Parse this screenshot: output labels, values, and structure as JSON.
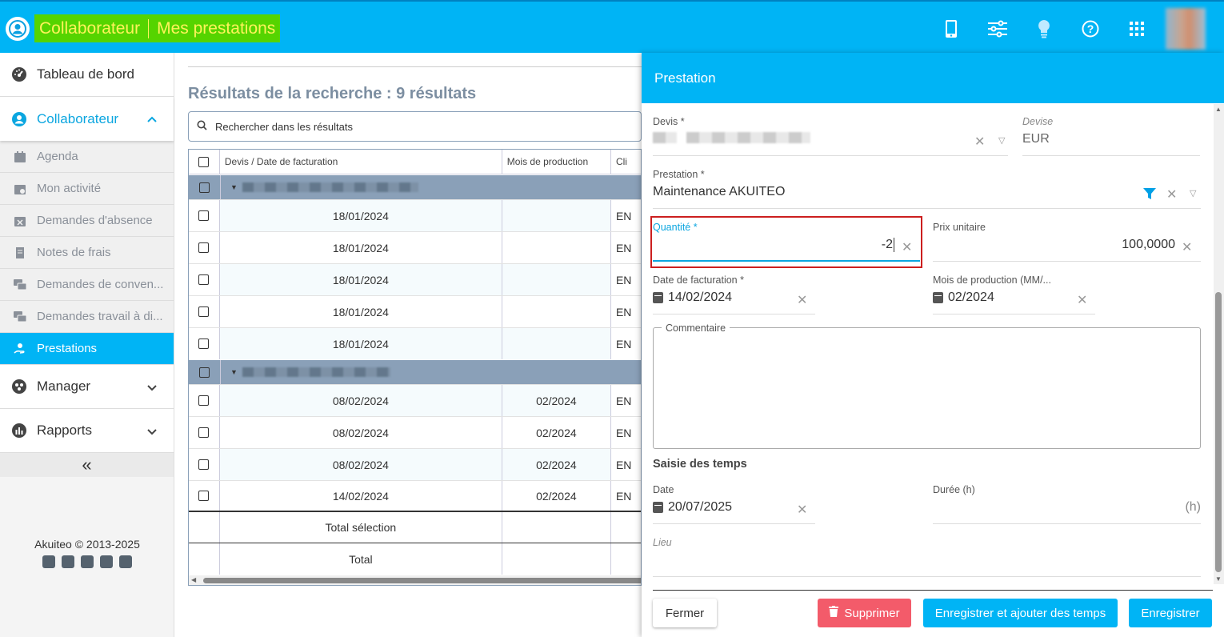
{
  "header": {
    "crumb_section": "Collaborateur",
    "crumb_page": "Mes prestations",
    "icons": [
      "user-circle-icon",
      "mobile-icon",
      "sliders-icon",
      "lightbulb-icon",
      "help-icon",
      "apps-grid-icon"
    ],
    "bg_color": "#00b4f5",
    "crumb_bg": "#55d400"
  },
  "sidebar": {
    "tableau": "Tableau de bord",
    "collaborateur": "Collaborateur",
    "subs": [
      {
        "label": "Agenda",
        "icon": "calendar-icon"
      },
      {
        "label": "Mon activité",
        "icon": "calendar-user-icon"
      },
      {
        "label": "Demandes d'absence",
        "icon": "calendar-x-icon"
      },
      {
        "label": "Notes de frais",
        "icon": "receipt-icon"
      },
      {
        "label": "Demandes de conven...",
        "icon": "chat-icon"
      },
      {
        "label": "Demandes travail à di...",
        "icon": "chat-icon"
      },
      {
        "label": "Prestations",
        "icon": "hand-service-icon"
      }
    ],
    "manager": "Manager",
    "rapports": "Rapports",
    "collapse": "«",
    "footer": "Akuiteo © 2013-2025"
  },
  "main": {
    "title": "Résultats de la recherche : 9 résultats",
    "search_placeholder": "Rechercher dans les résultats",
    "columns": [
      "Devis / Date de facturation",
      "Mois de production",
      "Cli"
    ],
    "rows_group1": [
      {
        "date": "18/01/2024",
        "mois": "",
        "cli": "EN"
      },
      {
        "date": "18/01/2024",
        "mois": "",
        "cli": "EN"
      },
      {
        "date": "18/01/2024",
        "mois": "",
        "cli": "EN"
      },
      {
        "date": "18/01/2024",
        "mois": "",
        "cli": "EN"
      },
      {
        "date": "18/01/2024",
        "mois": "",
        "cli": "EN"
      }
    ],
    "rows_group2": [
      {
        "date": "08/02/2024",
        "mois": "02/2024",
        "cli": "EN"
      },
      {
        "date": "08/02/2024",
        "mois": "02/2024",
        "cli": "EN"
      },
      {
        "date": "08/02/2024",
        "mois": "02/2024",
        "cli": "EN"
      },
      {
        "date": "14/02/2024",
        "mois": "02/2024",
        "cli": "EN"
      }
    ],
    "total_selection": "Total sélection",
    "total": "Total"
  },
  "panel": {
    "title": "Prestation",
    "devis_label": "Devis *",
    "devise_label": "Devise",
    "devise_value": "EUR",
    "prestation_label": "Prestation *",
    "prestation_value": "Maintenance AKUITEO",
    "quantite_label": "Quantité *",
    "quantite_value": "-2",
    "prix_label": "Prix unitaire",
    "prix_value": "100,0000",
    "date_fact_label": "Date de facturation *",
    "date_fact_value": "14/02/2024",
    "mois_prod_label": "Mois de production (MM/...",
    "mois_prod_value": "02/2024",
    "commentaire_label": "Commentaire",
    "saisie_title": "Saisie des temps",
    "date_label": "Date",
    "date_value": "20/07/2025",
    "duree_label": "Durée (h)",
    "duree_unit": "(h)",
    "lieu_label": "Lieu",
    "btn_fermer": "Fermer",
    "btn_supprimer": "Supprimer",
    "btn_enreg_temps": "Enregistrer et ajouter des temps",
    "btn_enregistrer": "Enregistrer"
  }
}
